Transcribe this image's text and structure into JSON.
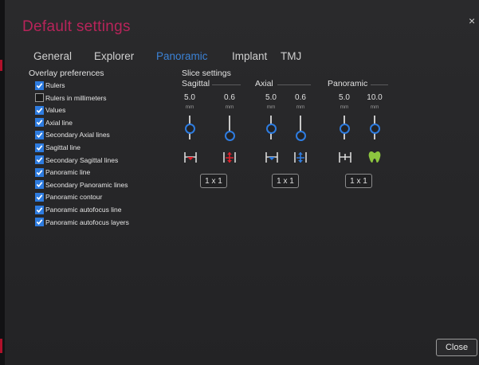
{
  "dialog": {
    "title": "Default settings",
    "close_glyph": "×"
  },
  "tabs": [
    {
      "label": "General",
      "active": false
    },
    {
      "label": "Explorer",
      "active": false
    },
    {
      "label": "Panoramic",
      "active": true
    },
    {
      "label": "Implant",
      "active": false
    },
    {
      "label": "TMJ",
      "active": false
    }
  ],
  "overlay": {
    "title": "Overlay preferences",
    "items": [
      {
        "label": "Rulers",
        "checked": true
      },
      {
        "label": "Rulers in millimeters",
        "checked": false
      },
      {
        "label": "Values",
        "checked": true
      },
      {
        "label": "Axial line",
        "checked": true
      },
      {
        "label": "Secondary Axial lines",
        "checked": true
      },
      {
        "label": "Sagittal line",
        "checked": true
      },
      {
        "label": "Secondary Sagittal lines",
        "checked": true
      },
      {
        "label": "Panoramic line",
        "checked": true
      },
      {
        "label": "Secondary Panoramic lines",
        "checked": true
      },
      {
        "label": "Panoramic contour",
        "checked": true
      },
      {
        "label": "Panoramic autofocus line",
        "checked": true
      },
      {
        "label": "Panoramic autofocus layers",
        "checked": true
      }
    ]
  },
  "slice": {
    "title": "Slice settings",
    "groups": [
      {
        "label": "Sagittal",
        "columns": [
          {
            "value": "5.0",
            "unit": "mm",
            "level": 0.55,
            "icon": "slice-thickness-icon"
          },
          {
            "value": "0.6",
            "unit": "mm",
            "level": 0.85,
            "icon": "slice-spacing-icon"
          }
        ],
        "layout": "1 x 1"
      },
      {
        "label": "Axial",
        "columns": [
          {
            "value": "5.0",
            "unit": "mm",
            "level": 0.55,
            "icon": "slice-thickness-icon"
          },
          {
            "value": "0.6",
            "unit": "mm",
            "level": 0.85,
            "icon": "slice-spacing-icon"
          }
        ],
        "layout": "1 x 1"
      },
      {
        "label": "Panoramic",
        "columns": [
          {
            "value": "5.0",
            "unit": "mm",
            "level": 0.55,
            "icon": "slice-thickness-icon"
          },
          {
            "value": "10.0",
            "unit": "mm",
            "level": 0.55,
            "icon": "tooth-icon"
          }
        ],
        "layout": "1 x 1"
      }
    ]
  },
  "footer": {
    "close_label": "Close"
  },
  "colors": {
    "accent": "#2e7ce0",
    "title": "#b8245a",
    "arrow_red": "#e0202a",
    "arrow_blue": "#2e7ce0",
    "tooth_green": "#8dc63f"
  }
}
